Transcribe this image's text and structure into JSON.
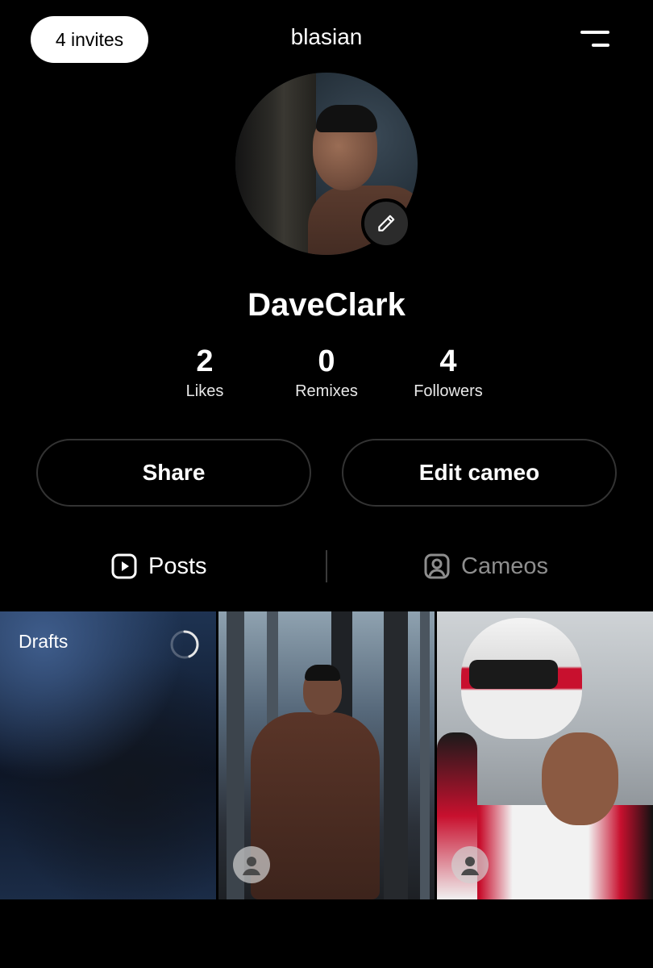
{
  "header": {
    "invites_label": "4 invites",
    "username": "blasian",
    "menu_icon": "menu-icon"
  },
  "profile": {
    "display_name": "DaveClark",
    "edit_icon": "pencil-icon"
  },
  "stats": [
    {
      "value": "2",
      "label": "Likes"
    },
    {
      "value": "0",
      "label": "Remixes"
    },
    {
      "value": "4",
      "label": "Followers"
    }
  ],
  "actions": {
    "share_label": "Share",
    "edit_cameo_label": "Edit cameo"
  },
  "tabs": [
    {
      "label": "Posts",
      "icon": "play-square-icon",
      "active": true
    },
    {
      "label": "Cameos",
      "icon": "person-square-icon",
      "active": false
    }
  ],
  "grid": {
    "drafts_label": "Drafts",
    "drafts_icon": "loading-spinner-icon",
    "items_icon": "person-icon"
  },
  "colors": {
    "background": "#000000",
    "text": "#ffffff",
    "inactive_tab": "#8e8e8e",
    "button_border": "#333333"
  }
}
